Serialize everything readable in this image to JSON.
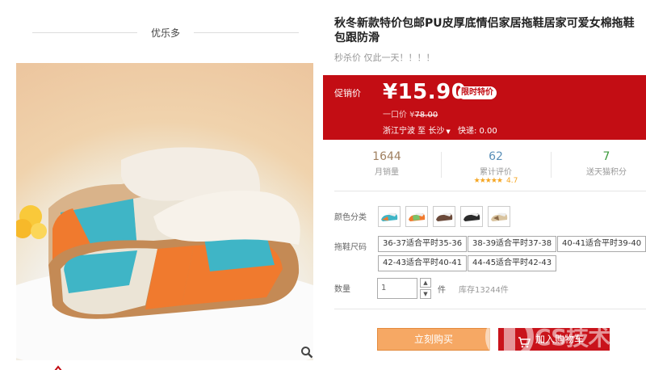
{
  "gallery": {
    "shop_name": "优乐多"
  },
  "product": {
    "title_line1": "秋冬新款特价包邮PU皮厚底情侣家居拖鞋居家可爱女棉拖鞋",
    "title_line2": "包跟防滑",
    "subtitle": "秒杀价 仅此一天！！！！"
  },
  "promo": {
    "label": "促销价",
    "price": "¥15.90",
    "badge": "限时特价",
    "orig_label": "一口价 ¥",
    "orig_price": "78.00",
    "ship_from": "浙江宁波 至",
    "ship_to": "长沙",
    "caret": "▼",
    "ship_fee": "快递: 0.00",
    "bg_color": "#c30d14"
  },
  "stats": {
    "monthly_sales": {
      "value": "1644",
      "label": "月销量"
    },
    "reviews": {
      "value": "62",
      "label": "累计评价",
      "stars": "★★★★★",
      "score": "4.7"
    },
    "points": {
      "value": "7",
      "label": "送天猫积分"
    }
  },
  "options": {
    "color_label": "颜色分类",
    "size_label": "拖鞋尺码",
    "sizes": [
      "36-37适合平时35-36",
      "38-39适合平时37-38",
      "40-41适合平时39-40",
      "42-43适合平时40-41",
      "44-45适合平时42-43"
    ]
  },
  "quantity": {
    "label": "数量",
    "value": "1",
    "up": "▲",
    "down": "▼",
    "unit": "件",
    "stock": "库存13244件"
  },
  "actions": {
    "buy_now": "立刻购买",
    "add_to_cart": "加入购物车"
  },
  "watermark": {
    "text": "CS技术"
  },
  "colors": {
    "accent_red": "#c30d14",
    "buy_orange": "#f6a864",
    "cart_red": "#c9131b"
  }
}
